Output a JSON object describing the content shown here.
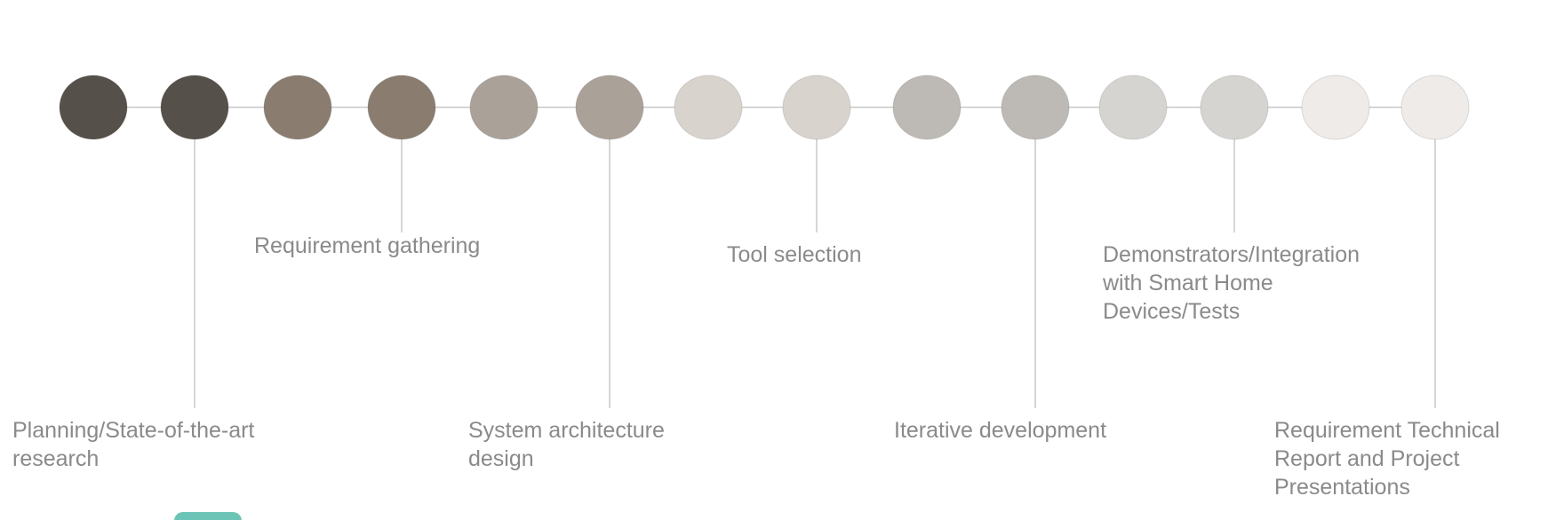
{
  "timeline": {
    "stages": [
      {
        "color": "#55504a"
      },
      {
        "color": "#55504a"
      },
      {
        "color": "#8a7d70"
      },
      {
        "color": "#8a7d70"
      },
      {
        "color": "#aaa198"
      },
      {
        "color": "#aaa198"
      },
      {
        "color": "#d9d3cd"
      },
      {
        "color": "#d9d3cd"
      },
      {
        "color": "#bdbab5"
      },
      {
        "color": "#bdbab5"
      },
      {
        "color": "#d6d4d1"
      },
      {
        "color": "#d6d4d1"
      },
      {
        "color": "#eeebe8"
      },
      {
        "color": "#eeebe8"
      }
    ],
    "connector_color": "#c8c8c8",
    "label_color": "#8a8a8a",
    "labels": [
      {
        "stage": 1,
        "text": "Planning/State-of-the-art\nresearch"
      },
      {
        "stage": 3,
        "text": "Requirement gathering"
      },
      {
        "stage": 5,
        "text": "System architecture\ndesign"
      },
      {
        "stage": 7,
        "text": "Tool selection"
      },
      {
        "stage": 9,
        "text": "Iterative development"
      },
      {
        "stage": 11,
        "text": "Demonstrators/Integration\nwith Smart Home\nDevices/Tests"
      },
      {
        "stage": 13,
        "text": "Requirement Technical\nReport and Project\nPresentations"
      }
    ]
  },
  "corner_tab": {
    "color": "#6cc4b6"
  }
}
